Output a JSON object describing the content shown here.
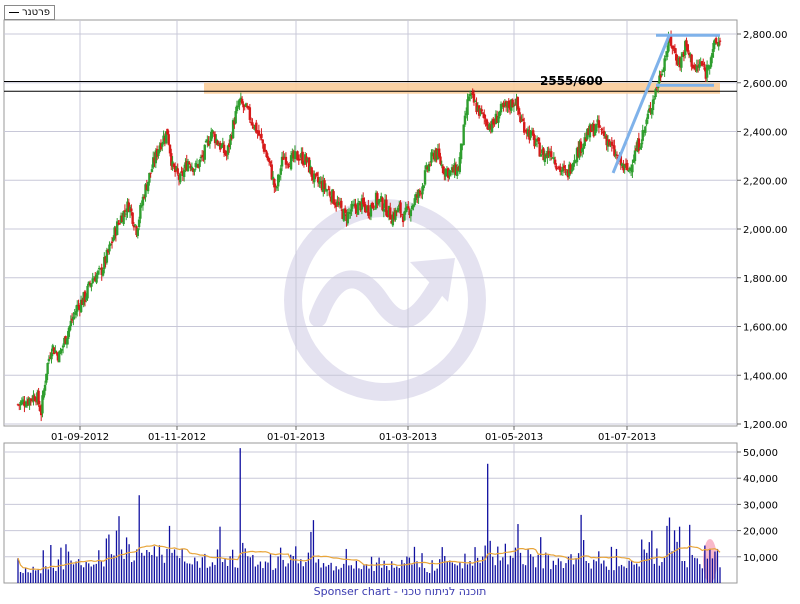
{
  "legend": {
    "label": "פרטנר"
  },
  "footer": {
    "text": "Sponser chart - תוכנה לניתוח טכני"
  },
  "annotation": {
    "text": "2555/600"
  },
  "colors": {
    "up": "#2f9e2f",
    "down": "#d61a1a",
    "volume": "#1010a0",
    "volume_ma": "#e8a53a",
    "grid": "#c8c8d8",
    "support_band": "#f9cc99",
    "trendline": "#7fb2ea",
    "watermark": "#e4e2f0",
    "highlight": "#f5a0b8"
  },
  "chart_data": [
    {
      "type": "candlestick",
      "title": "",
      "xlabel": "",
      "ylabel": "",
      "ylim": [
        1200,
        2850
      ],
      "x_tick_labels": [
        "01-09-2012",
        "01-11-2012",
        "01-01-2013",
        "01-03-2013",
        "01-05-2013",
        "01-07-2013"
      ],
      "y_tick_labels": [
        "1,200.00",
        "1,400.00",
        "1,600.00",
        "1,800.00",
        "2,000.00",
        "2,200.00",
        "2,400.00",
        "2,600.00",
        "2,800.00"
      ],
      "y_ticks": [
        1200,
        1400,
        1600,
        1800,
        2000,
        2200,
        2400,
        2600,
        2800
      ],
      "grid": true,
      "close_trajectory": [
        [
          0,
          1280
        ],
        [
          8,
          1300
        ],
        [
          14,
          1320
        ],
        [
          18,
          1250
        ],
        [
          22,
          1420
        ],
        [
          26,
          1520
        ],
        [
          32,
          1480
        ],
        [
          40,
          1600
        ],
        [
          46,
          1680
        ],
        [
          52,
          1720
        ],
        [
          58,
          1800
        ],
        [
          64,
          1820
        ],
        [
          70,
          1900
        ],
        [
          76,
          2000
        ],
        [
          80,
          2050
        ],
        [
          86,
          2100
        ],
        [
          92,
          2000
        ],
        [
          98,
          2150
        ],
        [
          104,
          2250
        ],
        [
          110,
          2350
        ],
        [
          116,
          2400
        ],
        [
          120,
          2250
        ],
        [
          126,
          2200
        ],
        [
          132,
          2280
        ],
        [
          138,
          2250
        ],
        [
          144,
          2300
        ],
        [
          150,
          2400
        ],
        [
          156,
          2350
        ],
        [
          162,
          2300
        ],
        [
          168,
          2450
        ],
        [
          172,
          2520
        ],
        [
          178,
          2480
        ],
        [
          184,
          2420
        ],
        [
          190,
          2350
        ],
        [
          196,
          2250
        ],
        [
          200,
          2150
        ],
        [
          206,
          2300
        ],
        [
          212,
          2280
        ],
        [
          218,
          2300
        ],
        [
          224,
          2280
        ],
        [
          230,
          2200
        ],
        [
          236,
          2180
        ],
        [
          242,
          2150
        ],
        [
          248,
          2100
        ],
        [
          254,
          2050
        ],
        [
          260,
          2080
        ],
        [
          266,
          2100
        ],
        [
          272,
          2080
        ],
        [
          278,
          2120
        ],
        [
          284,
          2100
        ],
        [
          290,
          2050
        ],
        [
          296,
          2080
        ],
        [
          300,
          2050
        ],
        [
          306,
          2100
        ],
        [
          312,
          2150
        ],
        [
          318,
          2250
        ],
        [
          324,
          2320
        ],
        [
          330,
          2250
        ],
        [
          336,
          2230
        ],
        [
          342,
          2250
        ],
        [
          346,
          2400
        ],
        [
          350,
          2550
        ],
        [
          356,
          2500
        ],
        [
          362,
          2450
        ],
        [
          368,
          2420
        ],
        [
          374,
          2480
        ],
        [
          380,
          2500
        ],
        [
          386,
          2530
        ],
        [
          390,
          2450
        ],
        [
          396,
          2400
        ],
        [
          402,
          2350
        ],
        [
          408,
          2300
        ],
        [
          414,
          2320
        ],
        [
          420,
          2250
        ],
        [
          426,
          2220
        ],
        [
          432,
          2300
        ],
        [
          438,
          2350
        ],
        [
          444,
          2400
        ],
        [
          450,
          2420
        ],
        [
          456,
          2380
        ],
        [
          462,
          2320
        ],
        [
          466,
          2280
        ],
        [
          470,
          2250
        ],
        [
          474,
          2240
        ],
        [
          478,
          2300
        ],
        [
          482,
          2350
        ],
        [
          486,
          2400
        ],
        [
          490,
          2480
        ],
        [
          494,
          2550
        ],
        [
          498,
          2620
        ],
        [
          502,
          2700
        ],
        [
          506,
          2780
        ],
        [
          510,
          2720
        ],
        [
          514,
          2680
        ],
        [
          518,
          2750
        ],
        [
          522,
          2700
        ],
        [
          526,
          2650
        ],
        [
          530,
          2680
        ],
        [
          534,
          2640
        ],
        [
          538,
          2720
        ],
        [
          542,
          2760
        ],
        [
          545,
          2770
        ]
      ],
      "annotations": {
        "support_band": [
          2555,
          2600
        ],
        "horizontal_lines": [
          2565,
          2605
        ],
        "resistance_line": 2795,
        "label": "2555/600",
        "trendline": [
          [
            462,
            2230
          ],
          [
            506,
            2800
          ]
        ]
      }
    },
    {
      "type": "bar",
      "title": "",
      "xlabel": "",
      "ylabel": "",
      "ylim": [
        0,
        52000
      ],
      "y_tick_labels": [
        "10,000",
        "20,000",
        "30,000",
        "40,000",
        "50,000"
      ],
      "y_ticks": [
        10000,
        20000,
        30000,
        40000,
        50000
      ],
      "grid": true,
      "series": [
        {
          "values": [
            9500,
            4200,
            3800,
            5600,
            4100,
            3900,
            6200,
            4800,
            5100,
            3700,
            12500,
            6400,
            5200,
            14500,
            5800,
            4600,
            9000,
            13500,
            5200,
            14800,
            12000,
            8600,
            7100,
            8200,
            9100,
            6800,
            6000,
            8000,
            7500,
            6300,
            7000,
            7300,
            12500,
            8500,
            6300,
            17000,
            18500,
            11000,
            10500,
            20000,
            25500,
            12800,
            9200,
            17400,
            14800,
            8000,
            8600,
            12800,
            33500,
            11500,
            10400,
            12600,
            11800,
            10700,
            14000,
            10100,
            14400,
            10800,
            7700,
            13000,
            21800,
            11500,
            12800,
            10400,
            9500,
            12800,
            8200,
            7500,
            7400,
            7100,
            9700,
            8300,
            5800,
            9800,
            11100,
            5800,
            6300,
            7900,
            6900,
            12800,
            21500,
            8000,
            9200,
            6500,
            10200,
            12700,
            6000,
            5800,
            51500,
            15300,
            13200,
            10200,
            9800,
            10700,
            6300,
            7000,
            8200,
            5700,
            8200,
            7800,
            11000,
            5000,
            5600,
            10100,
            13500,
            8800,
            6300,
            7500,
            10800,
            10300,
            14000,
            7500,
            9100,
            6400,
            8000,
            11600,
            19500,
            24000,
            7800,
            9100,
            5900,
            7600,
            6300,
            6900,
            7700,
            4800,
            6400,
            5200,
            5800,
            7300,
            13000,
            6700,
            6800,
            5500,
            8400,
            5600,
            5300,
            6800,
            7200,
            5500,
            10000,
            4600,
            7800,
            9700,
            5800,
            8500,
            6500,
            4900,
            8300,
            5800,
            6300,
            5700,
            8800,
            7500,
            10100,
            9700,
            7000,
            13800,
            8300,
            6000,
            11400,
            5700,
            4200,
            3800,
            8700,
            4700,
            5500,
            9100,
            13700,
            10300,
            8300,
            8600,
            7800,
            7200,
            6700,
            8000,
            5600,
            11200,
            7100,
            8400,
            6600,
            13700,
            9600,
            7700,
            10100,
            14300,
            45500,
            16100,
            10000,
            6800,
            13900,
            8600,
            9800,
            15000,
            7100,
            10400,
            9600,
            13500,
            22500,
            11500,
            7200,
            6800,
            13000,
            11000,
            10000,
            6000,
            10700,
            17500,
            5600,
            11600,
            10600,
            5300,
            8500,
            6900,
            9400,
            8300,
            5700,
            7600,
            10000,
            11000,
            7100,
            9500,
            11400,
            26000,
            16400,
            8400,
            7600,
            5500,
            8900,
            8300,
            12100,
            7400,
            8600,
            6300,
            5000,
            13800,
            4900,
            13000,
            6400,
            6900,
            6300,
            5700,
            8500,
            8600,
            7000,
            7400,
            6300,
            16600,
            12800,
            11500,
            15600,
            20000,
            7300,
            13200,
            6600,
            8000,
            9600,
            21800,
            25000,
            12100,
            20100,
            15700,
            21500,
            8400,
            8400,
            6000,
            22200,
            10700,
            9600,
            9400,
            7200,
            5600,
            14300,
            9300,
            13100,
            9400,
            12000,
            13000,
            6000
          ]
        }
      ],
      "moving_average": "volume_ma"
    }
  ]
}
